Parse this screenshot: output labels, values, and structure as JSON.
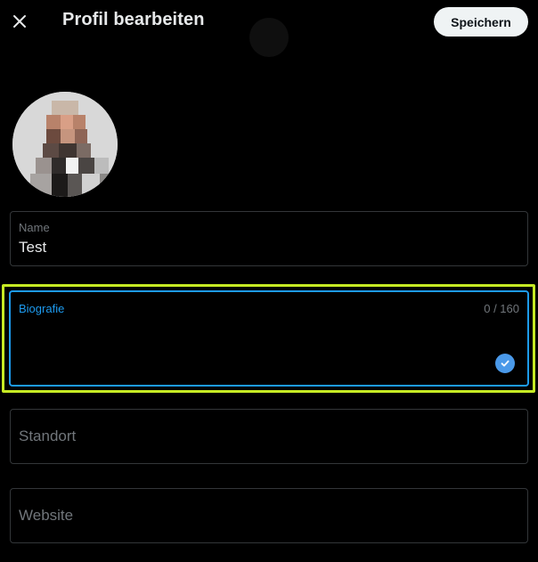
{
  "header": {
    "title": "Profil bearbeiten",
    "save_label": "Speichern",
    "close_icon": "close-icon"
  },
  "avatar": {
    "icon": "avatar-pixelated"
  },
  "fields": {
    "name": {
      "label": "Name",
      "value": "Test"
    },
    "bio": {
      "label": "Biografie",
      "counter": "0 / 160",
      "value": ""
    },
    "location": {
      "placeholder": "Standort",
      "value": ""
    },
    "website": {
      "placeholder": "Website",
      "value": ""
    }
  },
  "colors": {
    "background": "#000000",
    "accent": "#1d9bf0",
    "highlight": "#c6ea24",
    "border": "#333639",
    "muted_text": "#71767b",
    "save_button_bg": "#eff3f4"
  }
}
